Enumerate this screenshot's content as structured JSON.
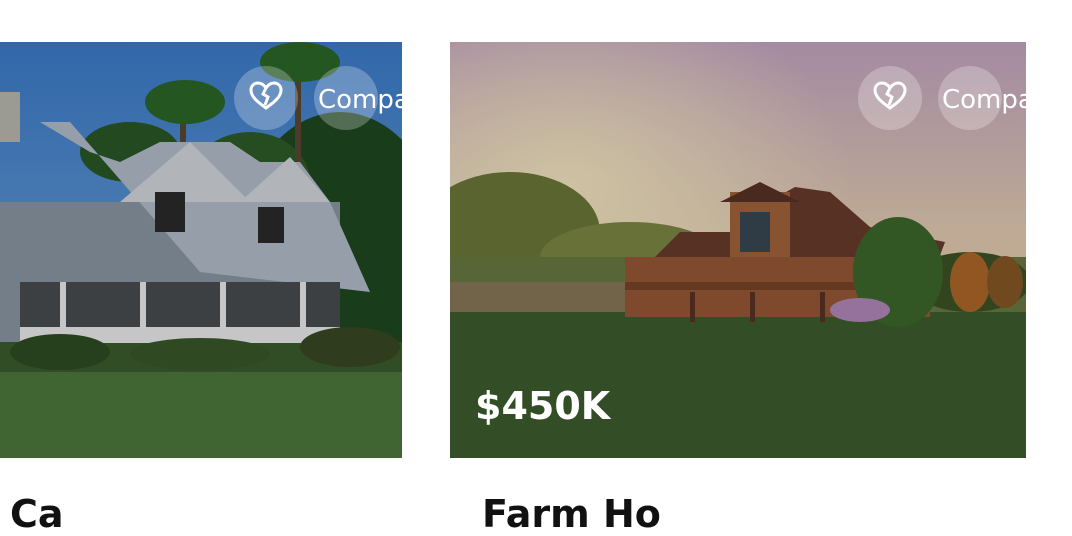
{
  "listings": [
    {
      "title": "Ca",
      "price": "",
      "compare_label": "Compa",
      "icons": {
        "favorite": "heart-icon"
      }
    },
    {
      "title": "Farm Ho",
      "price": "$450K",
      "compare_label": "Compa",
      "icons": {
        "favorite": "heart-icon"
      }
    }
  ],
  "colors": {
    "card1_sky": "#4a86c8",
    "card1_lawn": "#4e7a3e",
    "card2_sky": "#c9a7c4",
    "card2_lawn": "#3e5b2e"
  }
}
